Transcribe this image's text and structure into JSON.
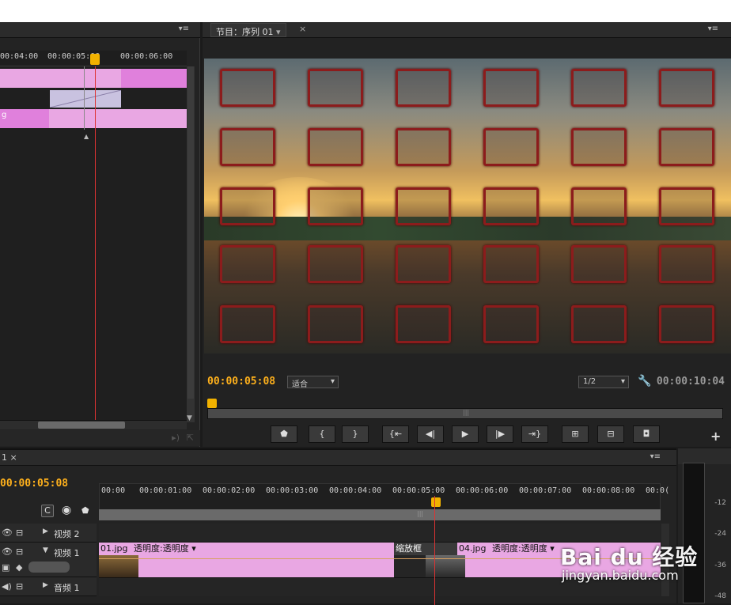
{
  "source_panel": {
    "ruler_ticks": [
      "00:04:00",
      "00:00:05:00",
      "00:00:06:00"
    ],
    "clip_labels": [
      "g",
      "g"
    ]
  },
  "program": {
    "tab_label": "节目：序列 01",
    "timecode_current": "00:00:05:08",
    "fit_label": "适合",
    "resolution_label": "1/2",
    "timecode_duration": "00:00:10:04",
    "buttons": [
      "marker-icon",
      "in-point-icon",
      "out-point-icon",
      "go-to-in-icon",
      "step-back-icon",
      "play-icon",
      "step-forward-icon",
      "go-to-out-icon",
      "lift-icon",
      "extract-icon",
      "export-frame-icon"
    ]
  },
  "timeline": {
    "tab_fragment": "1",
    "timecode": "00:00:05:08",
    "ruler_ticks": [
      "00:00",
      "00:00:01:00",
      "00:00:02:00",
      "00:00:03:00",
      "00:00:04:00",
      "00:00:05:00",
      "00:00:06:00",
      "00:00:07:00",
      "00:00:08:00",
      "00:0("
    ],
    "tracks": [
      {
        "name": "视频 2"
      },
      {
        "name": "视频 1"
      },
      {
        "name": "音频 1"
      }
    ],
    "clips": [
      {
        "name": "01.jpg",
        "effect": "透明度:透明度"
      },
      {
        "name": "缩放框",
        "effect": ""
      },
      {
        "name": "04.jpg",
        "effect": "透明度:透明度"
      }
    ]
  },
  "meter": {
    "labels": [
      "-12",
      "-24",
      "-36",
      "-48"
    ]
  },
  "watermark": {
    "brand": "Bai du 经验",
    "url": "jingyan.baidu.com"
  }
}
